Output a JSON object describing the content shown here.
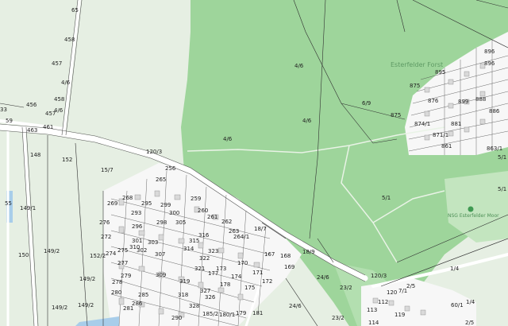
{
  "colors": {
    "open_land": "#e6efe3",
    "forest": "#9ed59b",
    "forest_light": "#c3e5bf",
    "settlement": "#f7f7f7",
    "building": "#d9d9d9",
    "parcel_line": "#2f2f2f",
    "road": "#ffffff",
    "water": "#a8cdea",
    "nsg_marker": "#3f9a52"
  },
  "place_labels": {
    "forest_name": "Esterfelder Forst",
    "nature_reserve": "NSG Esterfelder Moor"
  },
  "parcel_labels": {
    "p_4_6_a": "4/6",
    "p_4_6_b": "4/6",
    "p_4_6_c": "4/6",
    "p_4_6_d": "4/6",
    "p_4_6_e": "4/6",
    "p_6_9": "6/9",
    "p_875_a": "875",
    "p_875_b": "875",
    "p_5_1_a": "5/1",
    "p_5_1_b": "5/1",
    "p_1_4_a": "1/4",
    "p_1_4_b": "1/4",
    "p_18_9": "18/9",
    "p_18_7": "18/7",
    "p_24_6_a": "24/6",
    "p_24_6_b": "24/6",
    "p_23_2_a": "23/2",
    "p_23_2_b": "23/2",
    "p_120_3_a": "120/3",
    "p_120_3_b": "120/3",
    "p_15_7": "15/7",
    "p_149_1": "149/1",
    "p_149_2_a": "149/2",
    "p_149_2_b": "149/2",
    "p_149_2_c": "149/2",
    "p_149_2_d": "149/2",
    "p_148": "148",
    "p_152": "152",
    "p_150": "150",
    "p_55": "55",
    "p_33": "33",
    "p_456": "456",
    "p_457_a": "457",
    "p_457_b": "457",
    "p_458_a": "458",
    "p_458_b": "458",
    "p_463": "463",
    "p_461": "461",
    "p_59": "59",
    "p_65": "65",
    "p_895": "895",
    "p_896_a": "896",
    "p_896_b": "896",
    "p_899": "899",
    "p_888": "888",
    "p_886": "886",
    "p_881": "881",
    "p_876": "876",
    "p_874_1": "874/1",
    "p_871_1": "871/1",
    "p_863_1": "863/1",
    "p_861": "861",
    "p_5_1_c": "5/1",
    "p_60_1": "60/1",
    "p_113": "113",
    "p_114": "114",
    "p_119": "119",
    "p_120": "120",
    "p_112": "112",
    "p_2_5_a": "2/5",
    "p_2_5_b": "2/5",
    "p_7_1": "7/1",
    "p_256": "256",
    "p_265": "265",
    "p_268": "268",
    "p_269": "269",
    "p_261": "261",
    "p_260": "260",
    "p_259": "259",
    "p_263": "263",
    "p_293": "293",
    "p_295": "295",
    "p_299": "299",
    "p_300": "300",
    "p_305": "305",
    "p_310": "310",
    "p_315": "315",
    "p_316": "316",
    "p_314": "314",
    "p_322": "322",
    "p_323": "323",
    "p_321": "321",
    "p_327": "327",
    "p_170": "170",
    "p_171": "171",
    "p_172": "172",
    "p_173": "173",
    "p_174": "174",
    "p_175": "175",
    "p_177": "177",
    "p_178": "178",
    "p_167": "167",
    "p_168": "168",
    "p_169": "169",
    "p_276": "276",
    "p_272": "272",
    "p_274": "274",
    "p_275": "275",
    "p_277": "277",
    "p_278": "278",
    "p_279": "279",
    "p_280": "280",
    "p_281": "281",
    "p_285": "285",
    "p_286": "286",
    "p_290": "290",
    "p_302": "302",
    "p_303": "303",
    "p_307": "307",
    "p_309": "309",
    "p_319": "319",
    "p_326": "326",
    "p_328": "328",
    "p_296": "296",
    "p_298": "298",
    "p_301": "301",
    "p_318": "318",
    "p_264_1": "264/1",
    "p_152_2": "152/2",
    "p_181": "181",
    "p_179": "179",
    "p_185_2": "185/2",
    "p_180_1": "180/1",
    "p_262": "262"
  }
}
